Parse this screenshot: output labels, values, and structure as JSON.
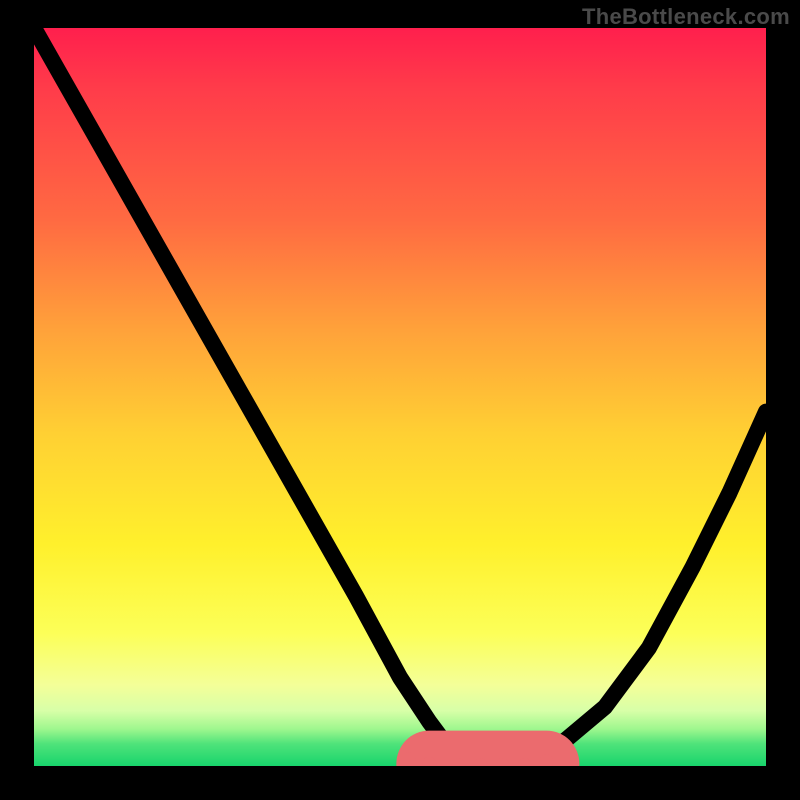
{
  "watermark": "TheBottleneck.com",
  "colors": {
    "background": "#000000",
    "curve": "#000000",
    "markers": "#eb6b6e",
    "gradient_stops": [
      "#ff1f4d",
      "#ff6a42",
      "#ffd033",
      "#fcff58",
      "#18d46c"
    ]
  },
  "chart_data": {
    "type": "line",
    "title": "",
    "xlabel": "",
    "ylabel": "",
    "xlim": [
      0,
      100
    ],
    "ylim": [
      0,
      100
    ],
    "grid": false,
    "legend": false,
    "series": [
      {
        "name": "left-branch",
        "x": [
          0,
          4,
          12,
          20,
          28,
          36,
          44,
          50,
          54,
          57,
          60
        ],
        "y": [
          100,
          93,
          79,
          65,
          51,
          37,
          23,
          12,
          6,
          2,
          0
        ]
      },
      {
        "name": "right-branch",
        "x": [
          60,
          66,
          72,
          78,
          84,
          90,
          95,
          100
        ],
        "y": [
          0,
          1,
          3,
          8,
          16,
          27,
          37,
          48
        ]
      },
      {
        "name": "optimal-zone-markers",
        "x": [
          51,
          54,
          58,
          61,
          64,
          67,
          70,
          73
        ],
        "y": [
          0.8,
          0.3,
          0.1,
          0.1,
          0.1,
          0.1,
          0.6,
          1.6
        ]
      }
    ],
    "annotations": []
  }
}
